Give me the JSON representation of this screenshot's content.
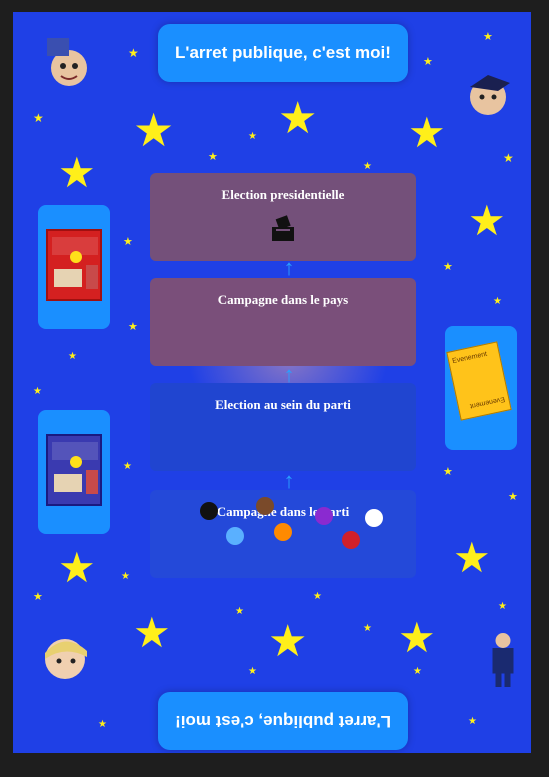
{
  "board": {
    "title_top": "L'arret publique, c'est moi!",
    "title_bottom": "L'arret publique, c'est moi!"
  },
  "track": {
    "steps": [
      {
        "label": "Election presidentielle"
      },
      {
        "label": "Campagne dans le pays"
      },
      {
        "label": "Election au sein du parti"
      },
      {
        "label": "Campagne dans le parti"
      }
    ]
  },
  "event_card": {
    "label_top": "Evenement",
    "label_bottom": "Evenement"
  },
  "tokens": [
    {
      "color": "#111111"
    },
    {
      "color": "#7a4a2a"
    },
    {
      "color": "#8a2ad0"
    },
    {
      "color": "#ffffff"
    },
    {
      "color": "#5ab0ff"
    },
    {
      "color": "#ff8a00"
    },
    {
      "color": "#d0202a"
    }
  ],
  "colors": {
    "board_bg": "#1f40e6",
    "star": "#ffef1a",
    "title_box": "#1a8fff",
    "arrow": "#2aa0ff"
  },
  "icons": [
    "star-icon",
    "ballot-box-icon",
    "arrow-up-icon",
    "slot-machine-icon",
    "event-card-icon",
    "pawn-token-icon",
    "caricature-icon"
  ]
}
